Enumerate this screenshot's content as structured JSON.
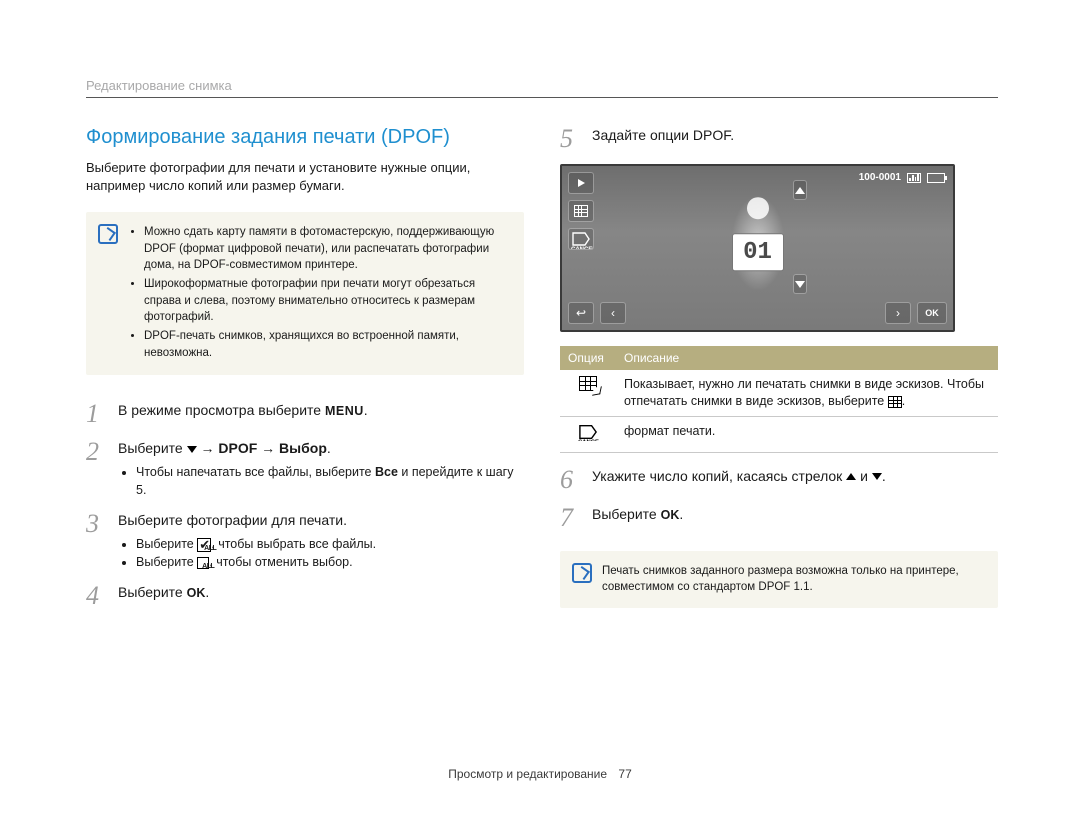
{
  "breadcrumb": "Редактирование снимка",
  "heading": "Формирование задания печати (DPOF)",
  "intro": "Выберите фотографии для печати и установите нужные опции, например число копий или размер бумаги.",
  "note1": {
    "items": [
      "Можно сдать карту памяти в фотомастерскую, поддерживающую DPOF (формат цифровой печати), или распечатать фотографии дома, на DPOF-совместимом принтере.",
      "Широкоформатные фотографии при печати могут обрезаться справа и слева, поэтому внимательно относитесь к размерам фотографий.",
      "DPOF-печать снимков, хранящихся во встроенной памяти, невозможна."
    ]
  },
  "steps_left": [
    {
      "num": "1",
      "line_parts": [
        "В режиме просмотра выберите ",
        "MENU",
        "."
      ]
    },
    {
      "num": "2",
      "line_parts": [
        "Выберите ",
        "chev-down",
        " → ",
        "DPOF",
        " → ",
        "Выбор",
        "."
      ],
      "bullets": [
        {
          "parts": [
            "Чтобы напечатать все файлы, выберите ",
            "Все",
            " и перейдите к шагу 5."
          ]
        }
      ]
    },
    {
      "num": "3",
      "line_parts": [
        "Выберите фотографии для печати."
      ],
      "bullets": [
        {
          "parts": [
            "Выберите ",
            "check-all",
            ", чтобы выбрать все файлы."
          ]
        },
        {
          "parts": [
            "Выберите ",
            "uncheck",
            ", чтобы отменить выбор."
          ]
        }
      ]
    },
    {
      "num": "4",
      "line_parts": [
        "Выберите ",
        "OK",
        "."
      ]
    }
  ],
  "steps_right_intro": {
    "num": "5",
    "line_parts": [
      "Задайте опции DPOF."
    ]
  },
  "screen": {
    "file_counter": "100-0001",
    "count": "01",
    "ok": "OK"
  },
  "table": {
    "head_option": "Опция",
    "head_desc": "Описание",
    "rows": [
      {
        "icon": "grid-flap",
        "desc_parts": [
          "Показывает, нужно ли печатать снимки в виде эскизов. Чтобы отпечатать снимки в виде эскизов, выберите ",
          "grid-inline",
          "."
        ]
      },
      {
        "icon": "cancel",
        "desc_parts": [
          "формат печати."
        ]
      }
    ]
  },
  "steps_right_post": [
    {
      "num": "6",
      "line_parts": [
        "Укажите число копий, касаясь стрелок ",
        "chev-up",
        " и ",
        "chev-down",
        "."
      ]
    },
    {
      "num": "7",
      "line_parts": [
        "Выберите ",
        "OK",
        "."
      ]
    }
  ],
  "note2": "Печать снимков заданного размера возможна только на принтере, совместимом со стандартом DPOF 1.1.",
  "footer_section": "Просмотр и редактирование",
  "footer_page": "77"
}
